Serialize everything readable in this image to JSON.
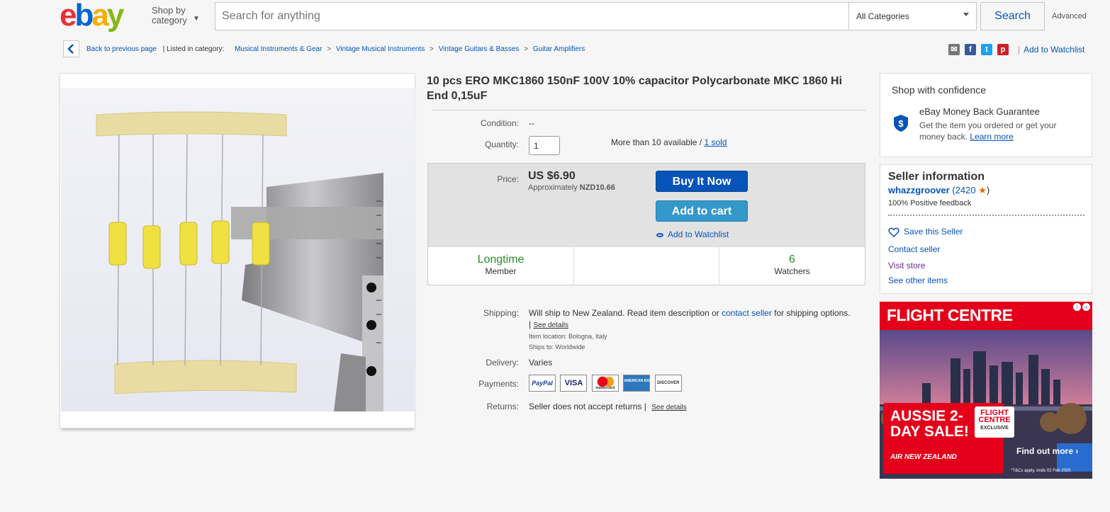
{
  "header": {
    "logo_letters": [
      "e",
      "b",
      "a",
      "y"
    ],
    "logo_colors": [
      "#e53238",
      "#0064d2",
      "#f5af02",
      "#86b817"
    ],
    "shop_by_line1": "Shop by",
    "shop_by_line2": "category",
    "search_placeholder": "Search for anything",
    "category_select": "All Categories",
    "search_button": "Search",
    "advanced_link": "Advanced"
  },
  "breadcrumb": {
    "back_label": "Back to previous page",
    "listed_in": "| Listed in category:",
    "categories": [
      "Musical Instruments & Gear",
      "Vintage Musical Instruments",
      "Vintage Guitars & Basses",
      "Guitar Amplifiers"
    ],
    "separator": ">",
    "add_to_watchlist": "Add to Watchlist",
    "divider": "|",
    "share_icons": [
      "email-icon",
      "facebook-icon",
      "twitter-icon",
      "pinterest-icon"
    ]
  },
  "item": {
    "title": "10 pcs ERO MKC1860 150nF 100V 10% capacitor Polycarbonate MKC 1860 Hi End 0,15uF",
    "condition_label": "Condition:",
    "condition_value": "--",
    "quantity_label": "Quantity:",
    "quantity_value": "1",
    "availability": "More than 10 available /",
    "sold": "1 sold",
    "price_label": "Price:",
    "price": "US $6.90",
    "approx_prefix": "Approximately",
    "approx_value": "NZD10.66",
    "buy_now": "Buy It Now",
    "add_to_cart": "Add to cart",
    "add_to_watchlist": "Add to Watchlist",
    "stats": [
      {
        "value": "Longtime",
        "label": "Member"
      },
      {
        "value": "",
        "label": ""
      },
      {
        "value": "6",
        "label": "Watchers"
      }
    ]
  },
  "shipping": {
    "shipping_label": "Shipping:",
    "shipping_text": "Will ship to New Zealand. Read item description or",
    "contact_seller": "contact seller",
    "shipping_text2": "for shipping",
    "shipping_text3": "options. |",
    "see_details": "See details",
    "item_location": "Item location:  Bologna, Italy",
    "ships_to": "Ships to:  Worldwide",
    "delivery_label": "Delivery:",
    "delivery_value": "Varies",
    "payments_label": "Payments:",
    "payment_methods": [
      "PayPal",
      "VISA",
      "mastercard",
      "AMERICAN EXPRESS",
      "DISCOVER"
    ],
    "returns_label": "Returns:",
    "returns_value": "Seller does not accept returns |",
    "returns_details": "See details"
  },
  "confidence": {
    "title": "Shop with confidence",
    "guarantee_title": "eBay Money Back Guarantee",
    "guarantee_text": "Get the item you ordered or get your money back.",
    "learn_more": "Learn more"
  },
  "seller": {
    "title": "Seller information",
    "name": "whazzgroover",
    "feedback_score": "(2420",
    "feedback_close": ")",
    "positive": "100% Positive feedback",
    "save_seller": "Save this Seller",
    "contact": "Contact seller",
    "visit_store": "Visit store",
    "other_items": "See other items"
  },
  "ad": {
    "brand": "FLIGHT CENTRE",
    "sale_line1": "AUSSIE 2-",
    "sale_line2": "DAY SALE!",
    "badge_line1": "FLIGHT",
    "badge_line2": "CENTRE",
    "badge_line3": "EXCLUSIVE",
    "airline": "AIR NEW ZEALAND",
    "cta": "Find out more ›",
    "terms": "*T&Cs apply, ends 02 Feb 2020"
  },
  "colors": {
    "link": "#0654ba",
    "buy_now": "#0654ba",
    "add_cart": "#3498ca",
    "longtime": "#2b8b2b",
    "visit_store": "#6a2c91",
    "ad_red": "#e4001b"
  }
}
